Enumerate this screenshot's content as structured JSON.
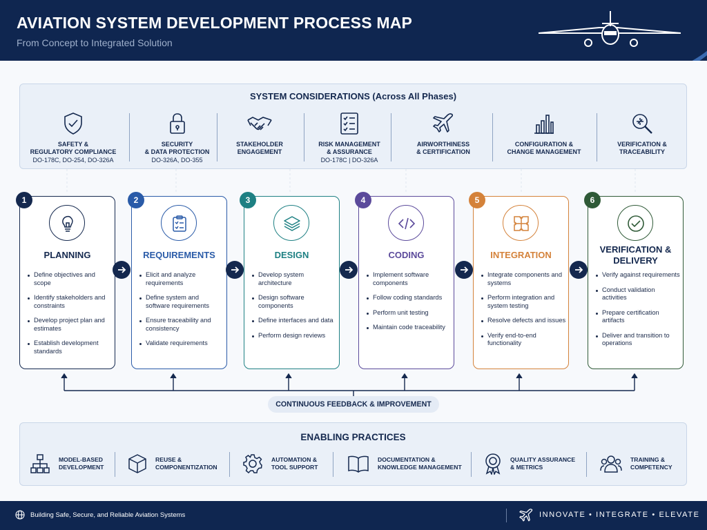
{
  "header": {
    "title": "AVIATION SYSTEM DEVELOPMENT PROCESS MAP",
    "subtitle": "From Concept to Integrated Solution"
  },
  "considerations": {
    "title": "SYSTEM CONSIDERATIONS (Across All Phases)",
    "items": [
      {
        "icon": "shield-check-icon",
        "line1": "SAFETY &",
        "line2": "REGULATORY COMPLIANCE",
        "std": "DO-178C, DO-254, DO-326A"
      },
      {
        "icon": "padlock-icon",
        "line1": "SECURITY",
        "line2": "& DATA PROTECTION",
        "std": "DO-326A, DO-355"
      },
      {
        "icon": "handshake-icon",
        "line1": "STAKEHOLDER",
        "line2": "ENGAGEMENT",
        "std": ""
      },
      {
        "icon": "checklist-icon",
        "line1": "RISK MANAGEMENT",
        "line2": "& ASSURANCE",
        "std": "DO-178C | DO-326A"
      },
      {
        "icon": "airplane-icon",
        "line1": "AIRWORTHINESS",
        "line2": "& CERTIFICATION",
        "std": ""
      },
      {
        "icon": "bar-chart-icon",
        "line1": "CONFIGURATION &",
        "line2": "CHANGE MANAGEMENT",
        "std": ""
      },
      {
        "icon": "magnifier-icon",
        "line1": "VERIFICATION &",
        "line2": "TRACEABILITY",
        "std": ""
      }
    ]
  },
  "phases": [
    {
      "num": "1",
      "title": "PLANNING",
      "color": "#14284e",
      "icon": "lightbulb-icon",
      "items": [
        "Define objectives and scope",
        "Identify stakeholders and constraints",
        "Develop project plan and estimates",
        "Establish development standards"
      ]
    },
    {
      "num": "2",
      "title": "REQUIREMENTS",
      "color": "#2a5ba8",
      "icon": "clipboard-checklist-icon",
      "items": [
        "Elicit and analyze requirements",
        "Define system and software requirements",
        "Ensure traceability and consistency",
        "Validate requirements"
      ]
    },
    {
      "num": "3",
      "title": "DESIGN",
      "color": "#1e8083",
      "icon": "layers-icon",
      "items": [
        "Develop system architecture",
        "Design software components",
        "Define interfaces and data",
        "Perform design reviews"
      ]
    },
    {
      "num": "4",
      "title": "CODING",
      "color": "#5b4a9b",
      "icon": "code-icon",
      "items": [
        "Implement software components",
        "Follow coding standards",
        "Perform unit testing",
        "Maintain code traceability"
      ]
    },
    {
      "num": "5",
      "title": "INTEGRATION",
      "color": "#d4823a",
      "icon": "puzzle-icon",
      "items": [
        "Integrate components and systems",
        "Perform integration and system testing",
        "Resolve defects and issues",
        "Verify end-to-end functionality"
      ]
    },
    {
      "num": "6",
      "title": "VERIFICATION & DELIVERY",
      "color": "#2f5a37",
      "icon": "check-circle-icon",
      "items": [
        "Verify against requirements",
        "Conduct validation activities",
        "Prepare certification artifacts",
        "Deliver and transition to operations"
      ]
    }
  ],
  "feedback": "CONTINUOUS FEEDBACK & IMPROVEMENT",
  "enabling": {
    "title": "ENABLING PRACTICES",
    "items": [
      {
        "icon": "hierarchy-icon",
        "line1": "MODEL-BASED",
        "line2": "DEVELOPMENT"
      },
      {
        "icon": "cube-icon",
        "line1": "REUSE &",
        "line2": "COMPONENTIZATION"
      },
      {
        "icon": "gear-icon",
        "line1": "AUTOMATION &",
        "line2": "TOOL SUPPORT"
      },
      {
        "icon": "book-icon",
        "line1": "DOCUMENTATION &",
        "line2": "KNOWLEDGE MANAGEMENT"
      },
      {
        "icon": "award-icon",
        "line1": "QUALITY ASSURANCE",
        "line2": "& METRICS"
      },
      {
        "icon": "people-icon",
        "line1": "TRAINING &",
        "line2": "COMPETENCY"
      }
    ]
  },
  "footer": {
    "left": "Building Safe, Secure, and Reliable Aviation Systems",
    "right": "INNOVATE • INTEGRATE • ELEVATE"
  }
}
